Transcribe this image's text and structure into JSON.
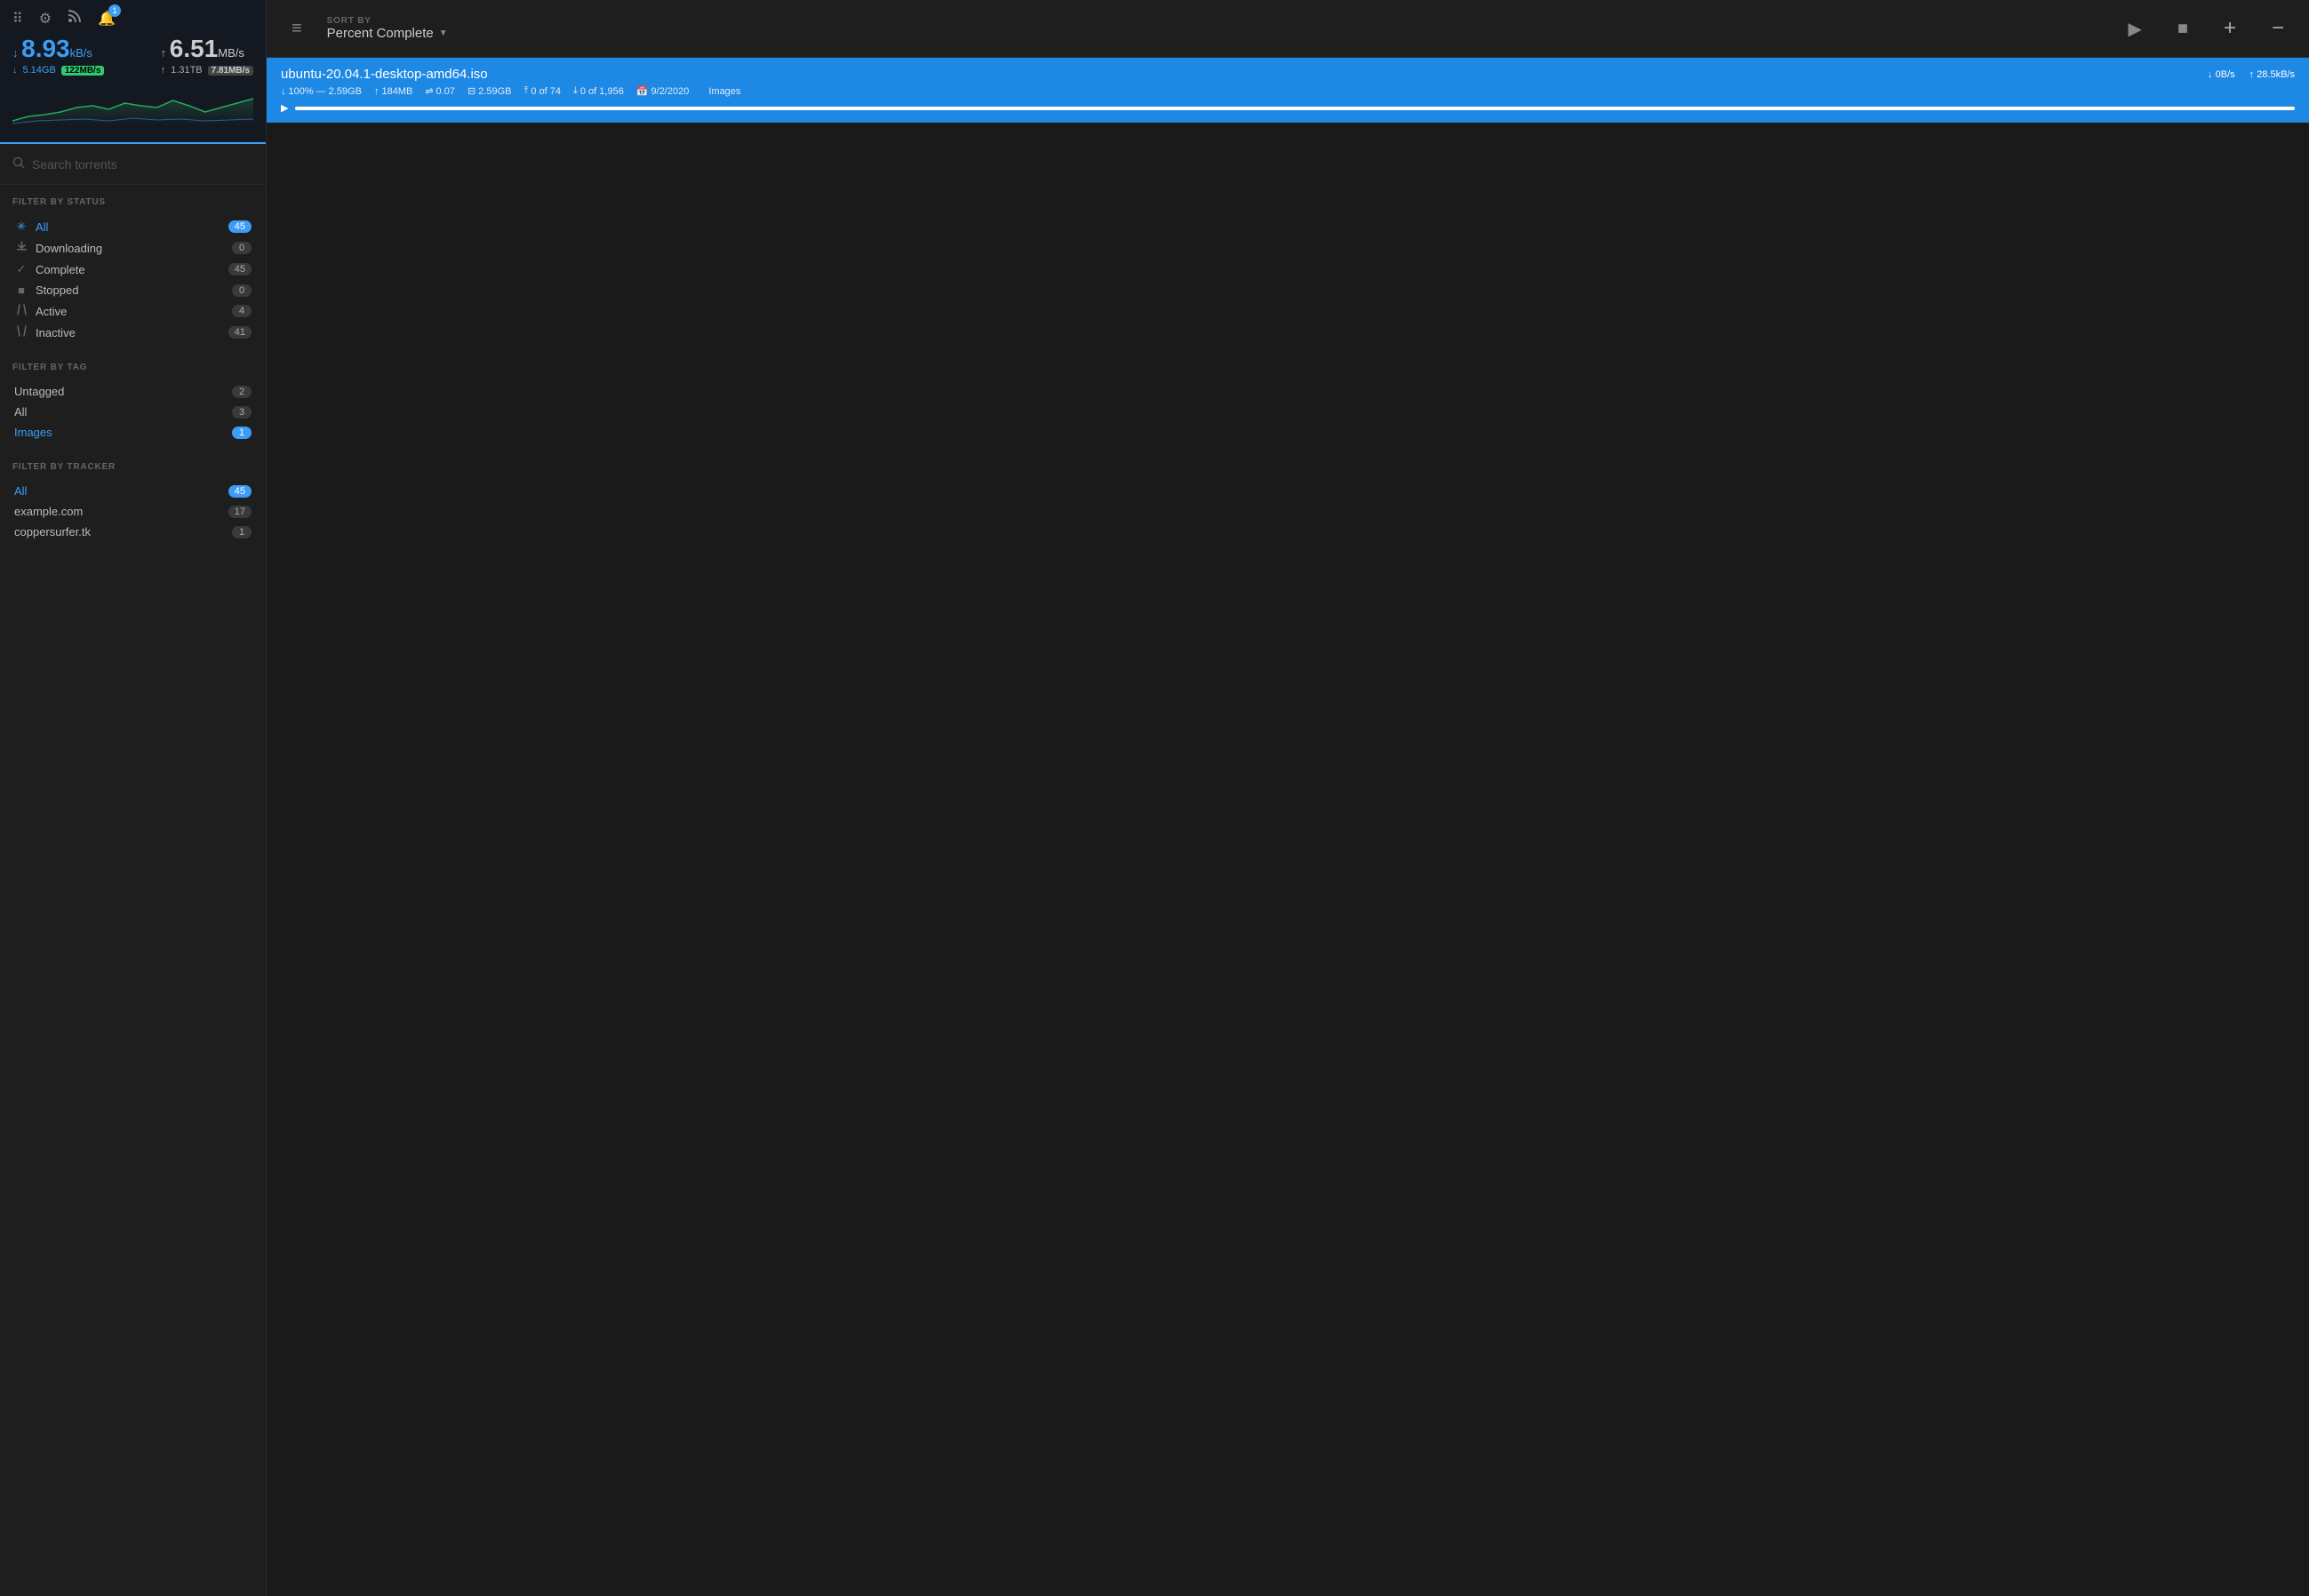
{
  "sidebar": {
    "toolbar": {
      "grid_icon": "⠿",
      "gear_icon": "⚙",
      "rss_icon": "◎",
      "bell_icon": "🔔",
      "notification_count": "1"
    },
    "stats": {
      "down_speed": "8.93",
      "down_unit": "kB/s",
      "down_total": "5.14GB",
      "down_badge": "122MB/s",
      "up_speed": "6.51",
      "up_unit": "MB/s",
      "up_total": "1.31TB",
      "up_badge": "7.81MB/s"
    },
    "search": {
      "placeholder": "Search torrents"
    },
    "filter_by_status": {
      "title": "FILTER BY STATUS",
      "items": [
        {
          "label": "All",
          "count": "45",
          "badge_blue": true,
          "icon": "✳",
          "icon_blue": true
        },
        {
          "label": "Downloading",
          "count": "0",
          "badge_blue": false,
          "icon": "↓",
          "icon_blue": false
        },
        {
          "label": "Complete",
          "count": "45",
          "badge_blue": false,
          "icon": "✓",
          "icon_blue": false
        },
        {
          "label": "Stopped",
          "count": "0",
          "badge_blue": false,
          "icon": "■",
          "icon_blue": false
        },
        {
          "label": "Active",
          "count": "4",
          "badge_blue": false,
          "icon": "↕",
          "icon_blue": false
        },
        {
          "label": "Inactive",
          "count": "41",
          "badge_blue": false,
          "icon": "↙",
          "icon_blue": false
        }
      ]
    },
    "filter_by_tag": {
      "title": "FILTER BY TAG",
      "items": [
        {
          "label": "Untagged",
          "count": "2",
          "badge_blue": false,
          "blue_label": false
        },
        {
          "label": "All",
          "count": "3",
          "badge_blue": false,
          "blue_label": false
        },
        {
          "label": "Images",
          "count": "1",
          "badge_blue": true,
          "blue_label": true
        }
      ]
    },
    "filter_by_tracker": {
      "title": "FILTER BY TRACKER",
      "items": [
        {
          "label": "All",
          "count": "45",
          "badge_blue": true,
          "blue_label": true
        },
        {
          "label": "example.com",
          "count": "17",
          "badge_blue": false,
          "blue_label": false
        },
        {
          "label": "coppersurfer.tk",
          "count": "1",
          "badge_blue": false,
          "blue_label": false
        }
      ]
    }
  },
  "header": {
    "hamburger": "≡",
    "sort_label": "SORT BY",
    "sort_value": "Percent Complete",
    "sort_arrow": "▼",
    "play_label": "▶",
    "stop_label": "■",
    "add_label": "+",
    "remove_label": "−"
  },
  "torrents": [
    {
      "name": "ubuntu-20.04.1-desktop-amd64.iso",
      "down_speed": "0B/s",
      "up_speed": "28.5kB/s",
      "percent": "100%",
      "size": "2.59GB",
      "uploaded": "184MB",
      "ratio": "0.07",
      "total_size": "2.59GB",
      "seeds": "0 of 74",
      "peers": "0 of 1,956",
      "date": "9/2/2020",
      "tag": "Images",
      "progress": 100
    }
  ]
}
